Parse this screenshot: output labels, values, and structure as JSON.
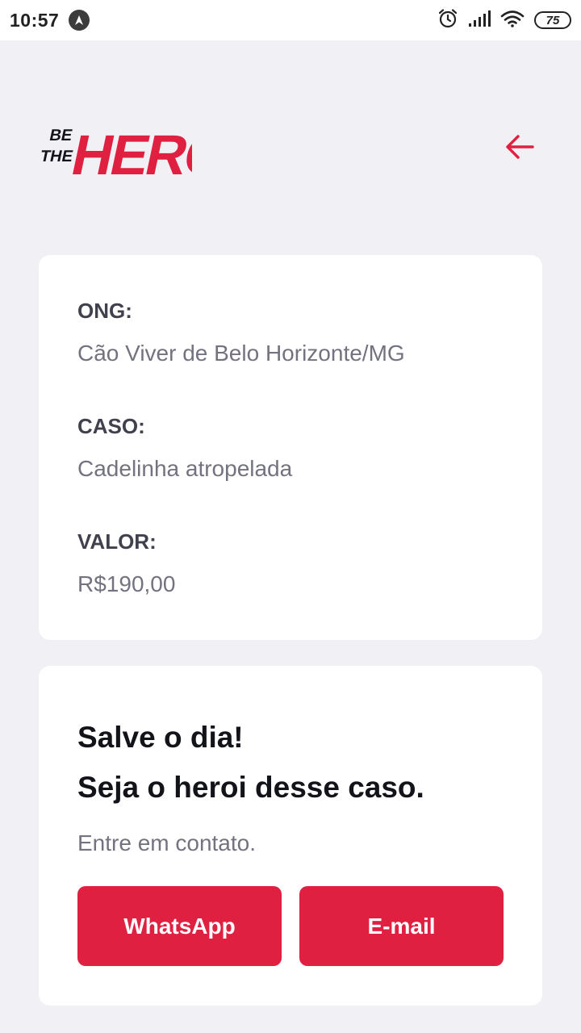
{
  "status_bar": {
    "time": "10:57",
    "battery_level": "75",
    "icons": [
      "navigation-app-icon",
      "alarm-icon",
      "signal-icon",
      "wifi-icon",
      "battery-icon"
    ]
  },
  "header": {
    "logo_text_small": [
      "BE",
      "THE"
    ],
    "logo_text_large": "HERO",
    "back_icon": "arrow-left-icon",
    "accent_color": "#e02041"
  },
  "incident": {
    "ong_label": "ONG:",
    "ong_value": "Cão Viver de Belo Horizonte/MG",
    "case_label": "CASO:",
    "case_value": "Cadelinha atropelada",
    "value_label": "VALOR:",
    "value_value": "R$190,00"
  },
  "contact": {
    "title_line1": "Salve o dia!",
    "title_line2": "Seja o heroi desse caso.",
    "description": "Entre em contato.",
    "whatsapp_label": "WhatsApp",
    "email_label": "E-mail"
  },
  "colors": {
    "background": "#f0f0f5",
    "card": "#ffffff",
    "primary": "#e02041",
    "label_text": "#41414d",
    "value_text": "#737380",
    "title_text": "#13131a"
  }
}
